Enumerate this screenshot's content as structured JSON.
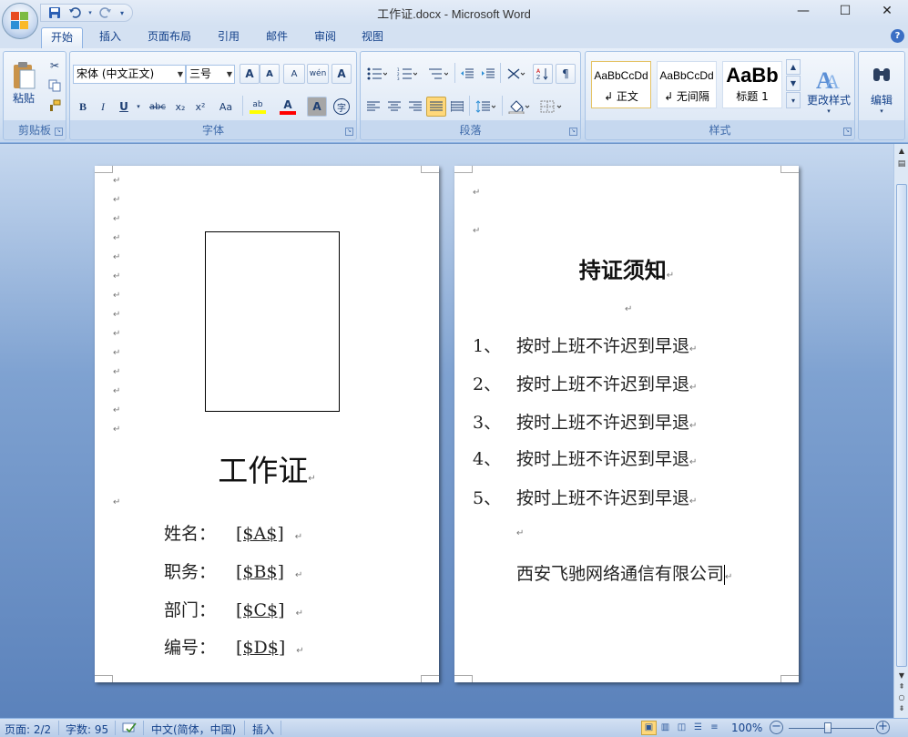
{
  "window": {
    "title": "工作证.docx - Microsoft Word",
    "minimize": "—",
    "maximize": "☐",
    "close": "✕"
  },
  "qat": {
    "save_icon": "save-icon",
    "undo_icon": "undo-icon",
    "redo_icon": "redo-icon",
    "customize_icon": "customize-qat-icon"
  },
  "tabs": [
    {
      "label": "开始",
      "active": true
    },
    {
      "label": "插入",
      "active": false
    },
    {
      "label": "页面布局",
      "active": false
    },
    {
      "label": "引用",
      "active": false
    },
    {
      "label": "邮件",
      "active": false
    },
    {
      "label": "审阅",
      "active": false
    },
    {
      "label": "视图",
      "active": false
    }
  ],
  "help": "?",
  "ribbon": {
    "clipboard": {
      "label": "剪贴板",
      "paste": "粘贴"
    },
    "font": {
      "label": "字体",
      "font_name": "宋体 (中文正文)",
      "font_size": "三号",
      "grow": "A",
      "shrink": "A",
      "clear": "A",
      "phonetic": "wén",
      "border_char": "A",
      "bold": "B",
      "italic": "I",
      "underline": "U",
      "strike": "abc",
      "subscript": "x₂",
      "superscript": "x²",
      "change_case": "Aa",
      "highlight": "ab",
      "font_color": "A",
      "shading_char": "A",
      "enclose": "字"
    },
    "paragraph": {
      "label": "段落"
    },
    "styles": {
      "label": "样式",
      "items": [
        {
          "sample": "AaBbCcDd",
          "name": "↲ 正文"
        },
        {
          "sample": "AaBbCcDd",
          "name": "↲ 无间隔"
        },
        {
          "sample": "AaBb",
          "name": "标题 1"
        }
      ],
      "change_styles": "更改样式"
    },
    "editing": {
      "label": "编辑"
    }
  },
  "document": {
    "page1": {
      "title": "工作证",
      "fields": [
        {
          "label": "姓名：",
          "value": "[$A$]"
        },
        {
          "label": "职务：",
          "value": "[$B$]"
        },
        {
          "label": "部门：",
          "value": "[$C$]"
        },
        {
          "label": "编号：",
          "value": "[$D$]"
        }
      ]
    },
    "page2": {
      "title": "持证须知",
      "rules": [
        {
          "num": "1、",
          "text": "按时上班不许迟到早退"
        },
        {
          "num": "2、",
          "text": "按时上班不许迟到早退"
        },
        {
          "num": "3、",
          "text": "按时上班不许迟到早退"
        },
        {
          "num": "4、",
          "text": "按时上班不许迟到早退"
        },
        {
          "num": "5、",
          "text": "按时上班不许迟到早退"
        }
      ],
      "company": "西安飞驰网络通信有限公司"
    },
    "para_mark": "↵"
  },
  "status": {
    "page": "页面: 2/2",
    "words": "字数: 95",
    "language": "中文(简体，中国)",
    "mode": "插入",
    "zoom": "100%",
    "zoom_minus": "−",
    "zoom_plus": "+"
  }
}
